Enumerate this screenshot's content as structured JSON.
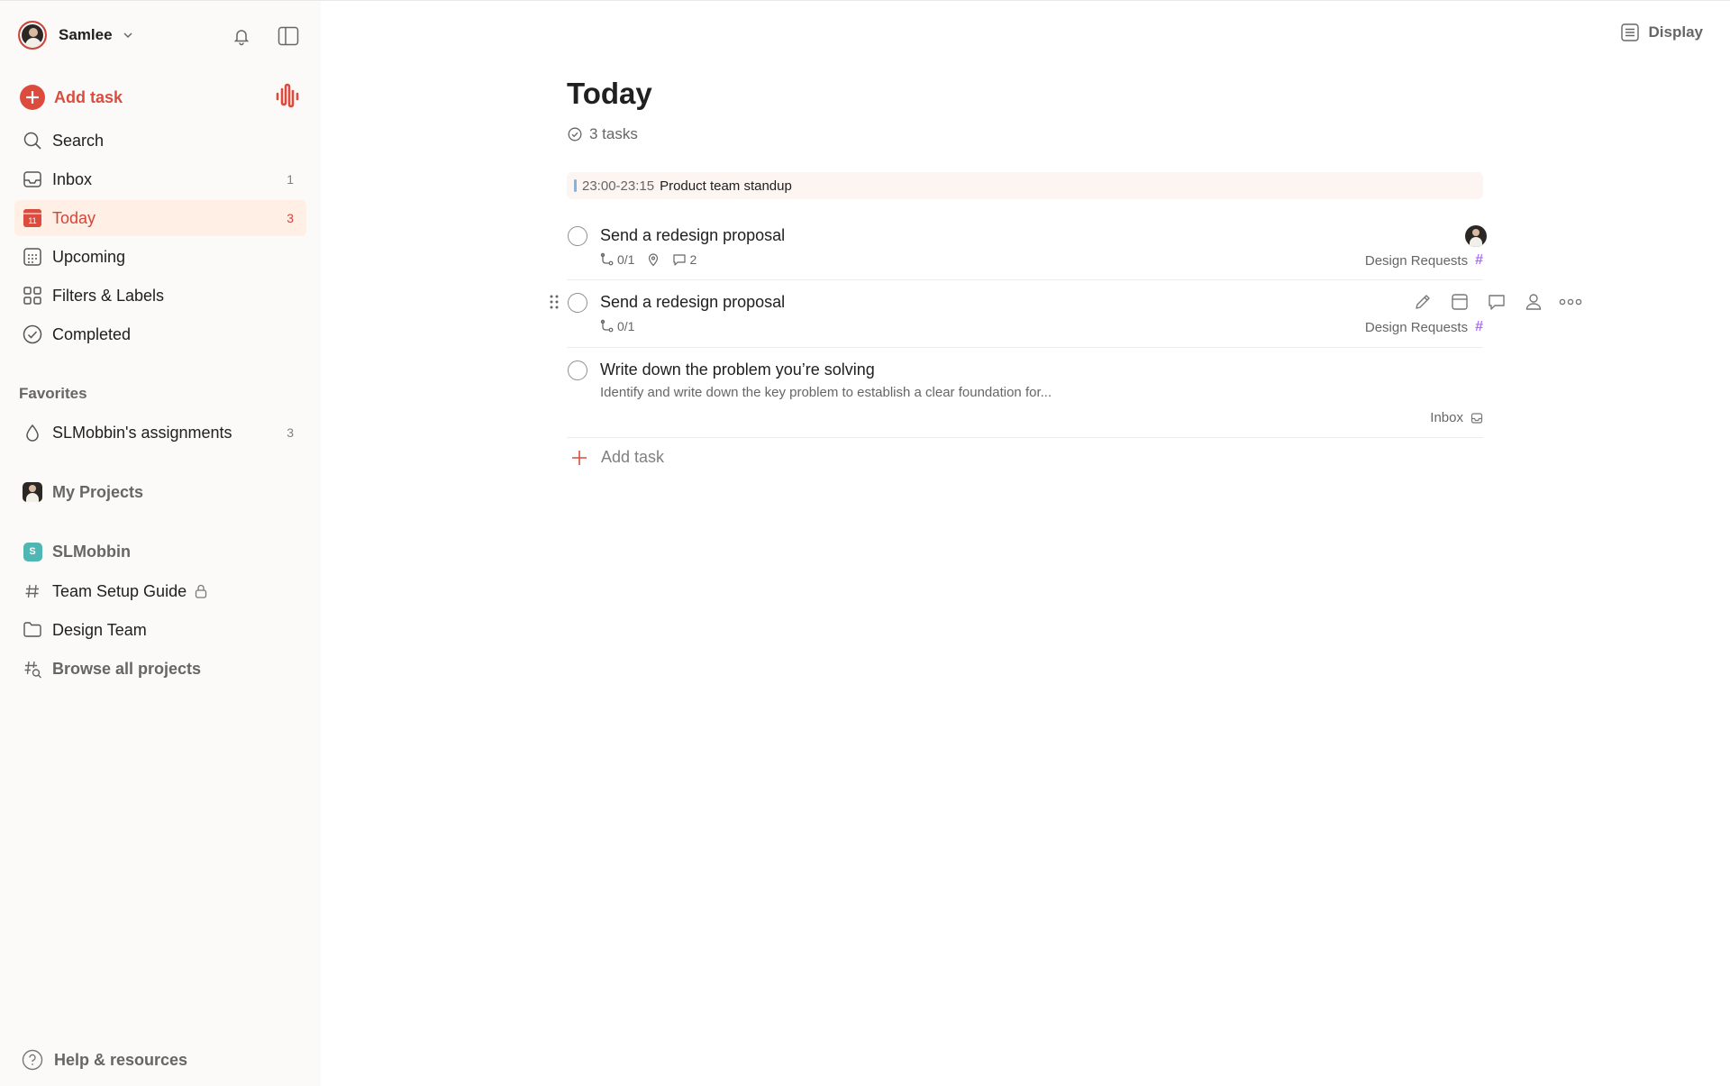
{
  "sidebar": {
    "user_name": "Samlee",
    "add_task_label": "Add task",
    "nav": [
      {
        "label": "Search",
        "count": ""
      },
      {
        "label": "Inbox",
        "count": "1"
      },
      {
        "label": "Today",
        "count": "3",
        "calendar_day": "11"
      },
      {
        "label": "Upcoming",
        "count": ""
      },
      {
        "label": "Filters & Labels",
        "count": ""
      },
      {
        "label": "Completed",
        "count": ""
      }
    ],
    "favorites_heading": "Favorites",
    "favorites": [
      {
        "label": "SLMobbin's assignments",
        "count": "3"
      }
    ],
    "my_projects_label": "My Projects",
    "workspace": {
      "badge_letter": "S",
      "name": "SLMobbin",
      "items": [
        {
          "label": "Team Setup Guide"
        },
        {
          "label": "Design Team"
        },
        {
          "label": "Browse all projects"
        }
      ]
    },
    "help_label": "Help & resources"
  },
  "main": {
    "display_label": "Display",
    "title": "Today",
    "task_count": "3 tasks",
    "event": {
      "time": "23:00-23:15",
      "name": "Product team standup"
    },
    "tasks": [
      {
        "title": "Send a redesign proposal",
        "subtasks": "0/1",
        "comments": "2",
        "project": "Design Requests"
      },
      {
        "title": "Send a redesign proposal",
        "subtasks": "0/1",
        "project": "Design Requests"
      },
      {
        "title": "Write down the problem you’re solving",
        "description": "Identify and write down the key problem to establish a clear foundation for...",
        "project": "Inbox"
      }
    ],
    "add_task_label": "Add task"
  },
  "colors": {
    "accent": "#dc4c3e",
    "sidebar_bg": "#fcfaf8",
    "active_bg": "#ffefe5",
    "project_hash": "#a970ff",
    "workspace_badge": "#4fb6b4",
    "event_bg": "#fdf5f2"
  }
}
